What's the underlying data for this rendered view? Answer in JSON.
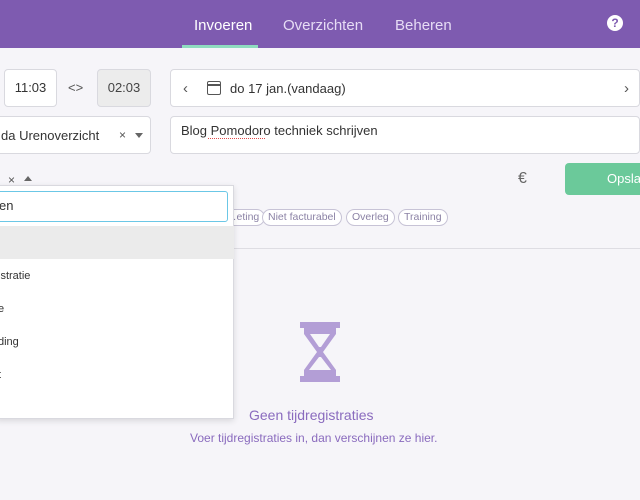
{
  "nav": {
    "tabs": [
      "Invoeren",
      "Overzichten",
      "Beheren"
    ],
    "active": "Invoeren",
    "help": "?"
  },
  "entry": {
    "start_time": "11:03",
    "swap_label": "<>",
    "duration": "02:03",
    "date": "do 17 jan.(vandaag)",
    "project": "da Urenoverzicht",
    "description": "Blog Pomodoro techniek schrijven",
    "clear": "×",
    "currency": "€",
    "save_label": "Opsla"
  },
  "tags": [
    "…eting",
    "Niet facturabel",
    "Overleg",
    "Training"
  ],
  "dropdown": {
    "search_value": "en",
    "items": [
      "",
      "istratie",
      "e",
      "ding",
      "t"
    ]
  },
  "empty": {
    "title": "Geen tijdregistraties",
    "subtitle": "Voer tijdregistraties in, dan verschijnen ze hier."
  },
  "colors": {
    "header": "#7e5bb0",
    "accent": "#8fdcc0",
    "save": "#6bc99a",
    "empty_text": "#8a6bbe"
  }
}
